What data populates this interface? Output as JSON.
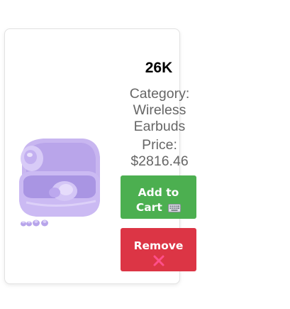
{
  "product": {
    "stock_label": "26K",
    "category_label": "Category: Wireless Earbuds",
    "price_label": "Price: $2816.46",
    "image_icon": "wireless-earbuds-case-image"
  },
  "actions": {
    "add_to_cart_label": "Add to Cart",
    "add_to_cart_icon": "keyboard-icon",
    "remove_label": "Remove",
    "remove_icon": "cross-mark-icon"
  },
  "colors": {
    "add_button": "#4caf50",
    "remove_button": "#dc3545",
    "remove_icon": "#ff4f8b",
    "text_secondary": "#666666",
    "product_lavender": "#c9b8f0"
  }
}
